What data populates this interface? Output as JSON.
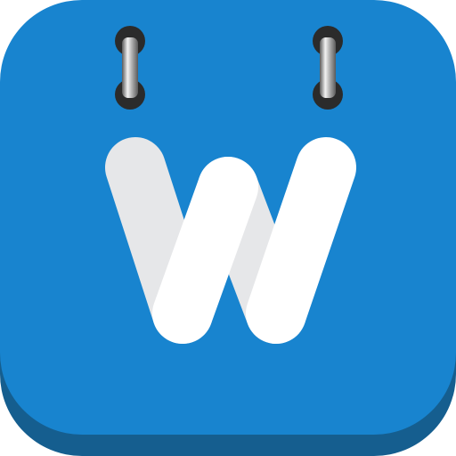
{
  "icon": {
    "glyph": "W",
    "colors": {
      "face": "#1884cf",
      "face_highlight": "#1f8fd9",
      "base": "#155e8f",
      "letter_front": "#ffffff",
      "letter_back": "#e6e7e9",
      "ring_dark": "#2b2b2b",
      "ring_metal_light": "#f2f2f2",
      "ring_metal_mid": "#a8a8a8",
      "ring_metal_dark": "#5a5a5a"
    },
    "icon_name": "calendar-w-app-icon"
  }
}
